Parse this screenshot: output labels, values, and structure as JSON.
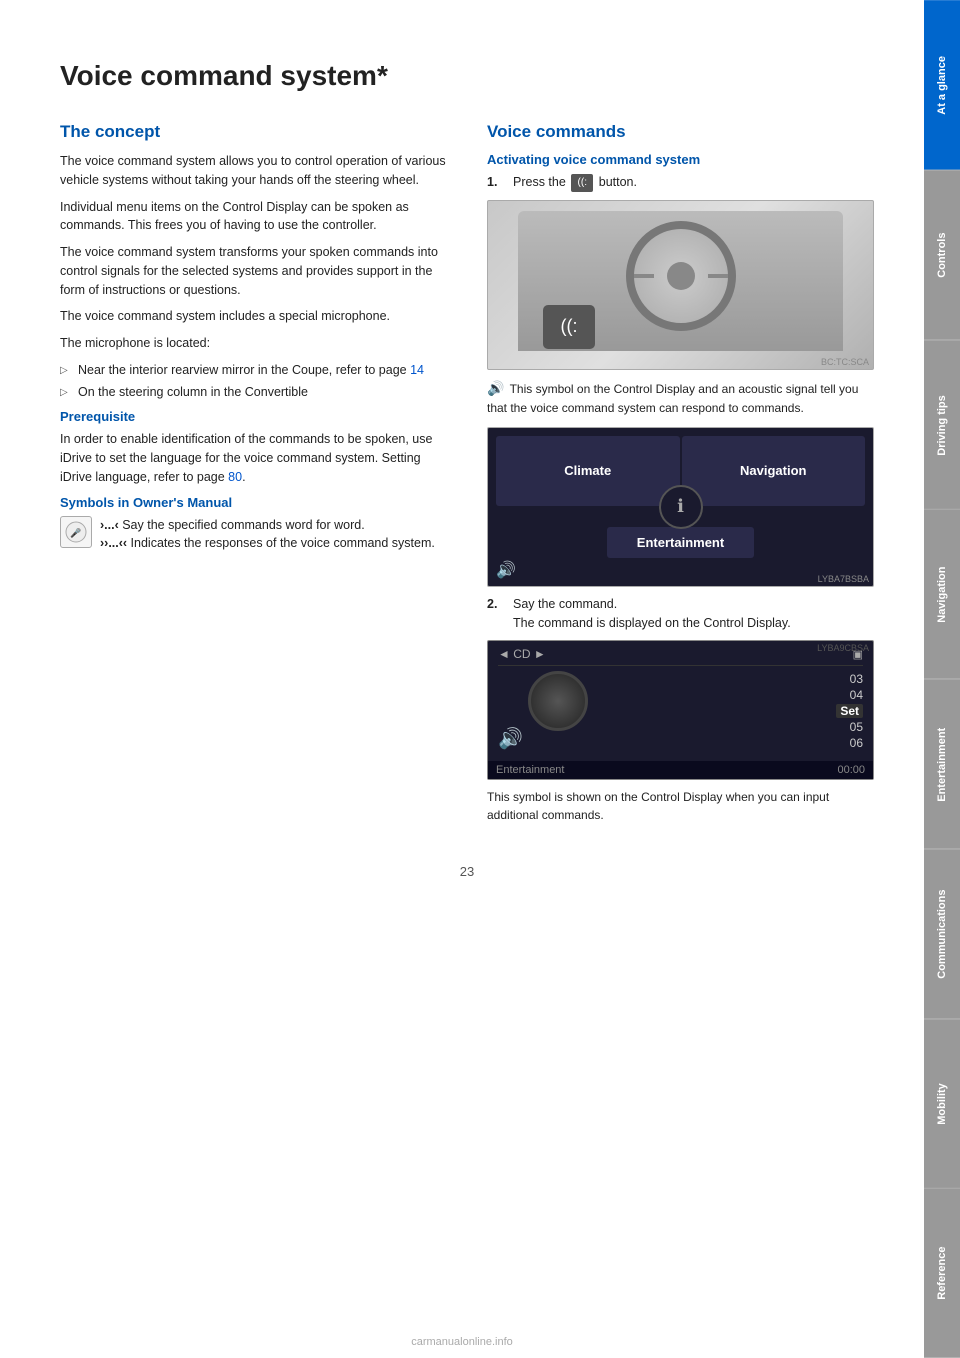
{
  "page": {
    "title": "Voice command system*",
    "number": "23",
    "watermark": "carmanualonline.info"
  },
  "sidebar": {
    "tabs": [
      {
        "label": "At a glance",
        "active": true
      },
      {
        "label": "Controls",
        "active": false
      },
      {
        "label": "Driving tips",
        "active": false
      },
      {
        "label": "Navigation",
        "active": false
      },
      {
        "label": "Entertainment",
        "active": false
      },
      {
        "label": "Communications",
        "active": false
      },
      {
        "label": "Mobility",
        "active": false
      },
      {
        "label": "Reference",
        "active": false
      }
    ]
  },
  "left_column": {
    "concept_heading": "The concept",
    "paragraphs": [
      "The voice command system allows you to control operation of various vehicle systems without taking your hands off the steering wheel.",
      "Individual menu items on the Control Display can be spoken as commands. This frees you of having to use the controller.",
      "The voice command system transforms your spoken commands into control signals for the selected systems and provides support in the form of instructions or questions.",
      "The voice command system includes a special microphone.",
      "The microphone is located:"
    ],
    "bullets": [
      "Near the interior rearview mirror in the Coupe, refer to page 14",
      "On the steering column in the Convertible"
    ],
    "prerequisite_heading": "Prerequisite",
    "prerequisite_text": "In order to enable identification of the commands to be spoken, use iDrive to set the language for the voice command system. Setting iDrive language, refer to page 80.",
    "symbols_heading": "Symbols in Owner's Manual",
    "symbol1_text": "›...‹ Say the specified commands word for word.",
    "symbol2_text": "››...‹‹ Indicates the responses of the voice command system."
  },
  "right_column": {
    "voice_commands_heading": "Voice commands",
    "activating_heading": "Activating voice command system",
    "step1_text": "Press the",
    "step1_button": "voice",
    "step1_suffix": "button.",
    "note1_text": "This symbol on the Control Display and an acoustic signal tell you that the voice command system can respond to commands.",
    "step2_num": "2.",
    "step2_text": "Say the command.\nThe command is displayed on the Control Display.",
    "note2_text": "This symbol is shown on the Control Display when you can input additional commands.",
    "menu_items": {
      "climate": "Climate",
      "navigation": "Navigation",
      "entertainment": "Entertainment"
    },
    "cd_header": "◄  CD  ►",
    "cd_tracks": [
      "03",
      "04",
      "05",
      "06"
    ],
    "cd_set": "Set",
    "cd_time": "00:00",
    "cd_footer": "Entertainment"
  }
}
